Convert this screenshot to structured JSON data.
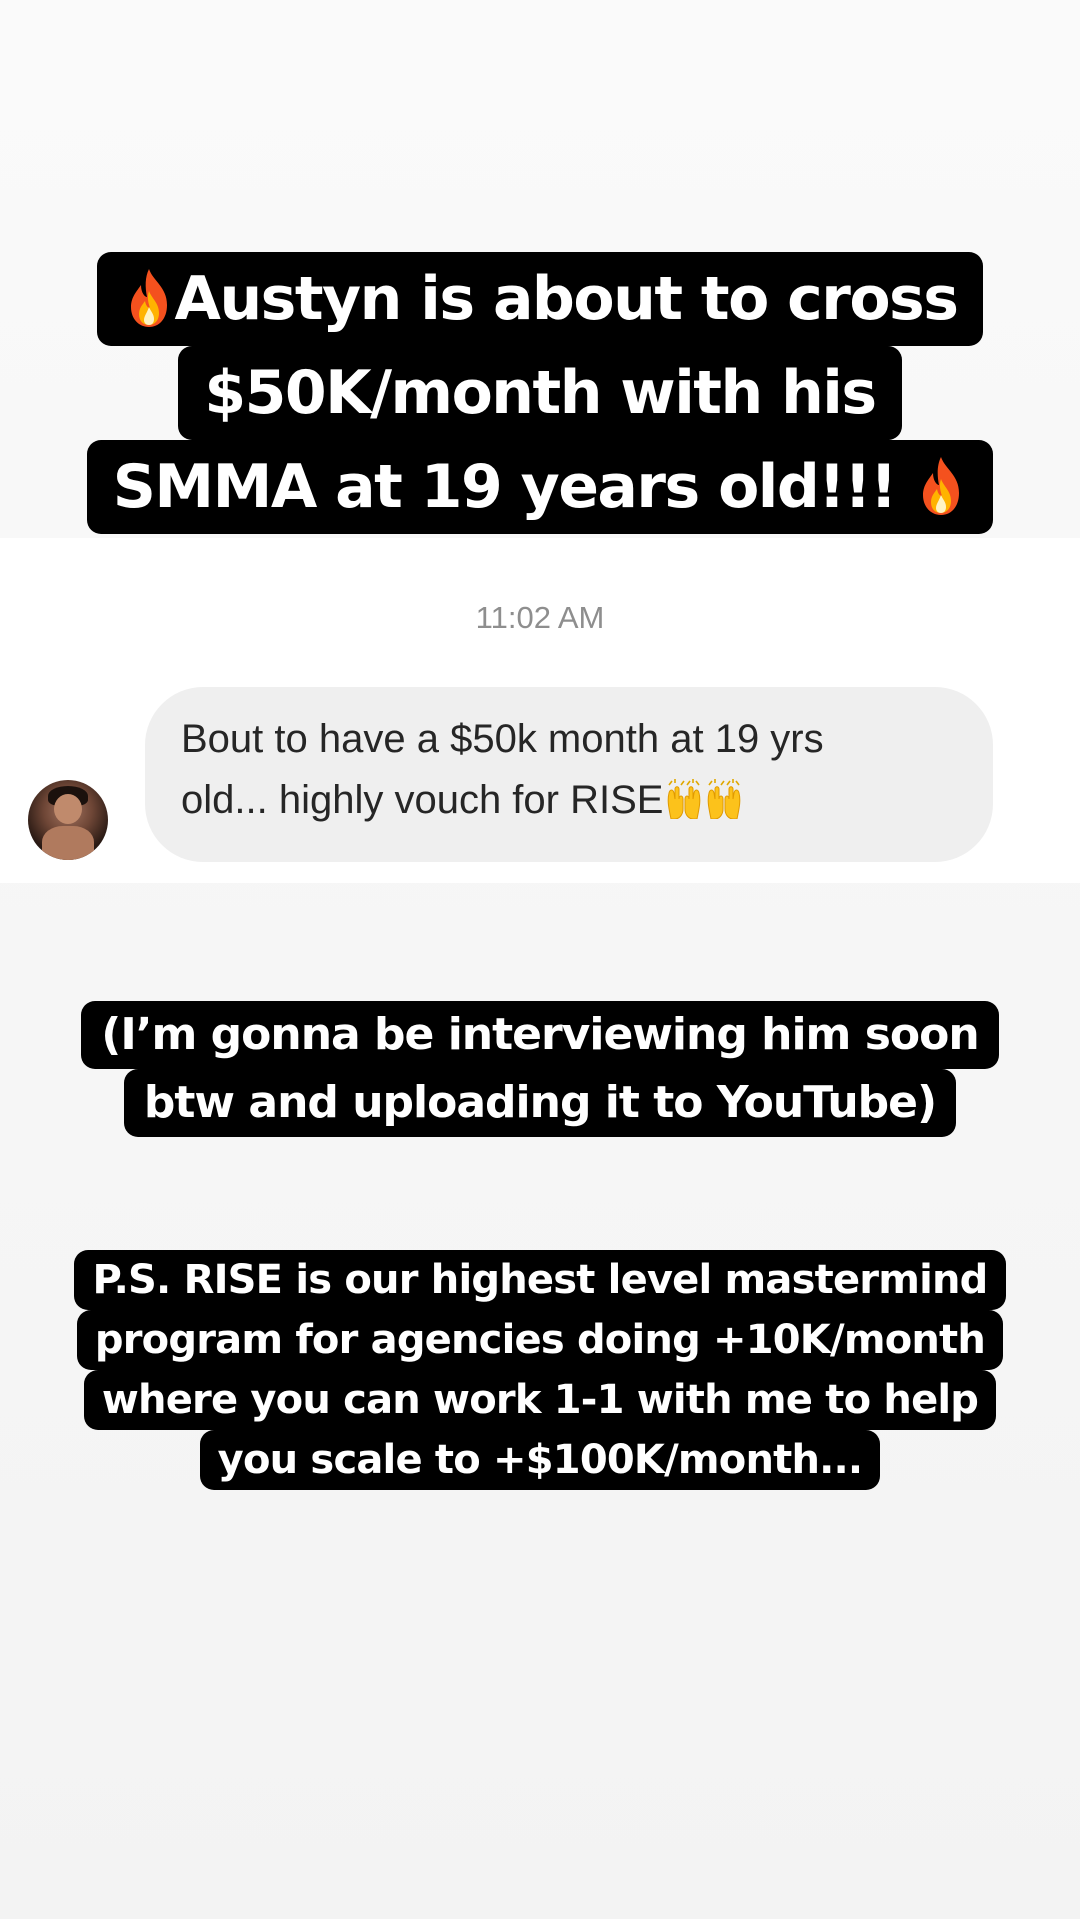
{
  "headline": {
    "lines": [
      "Austyn is about to cross",
      "$50K/month with his",
      "SMMA at 19 years old!!!"
    ],
    "leading_icon": "fire-emoji",
    "trailing_icon": "fire-emoji"
  },
  "dm": {
    "timestamp": "11:02 AM",
    "message_lines": [
      "Bout to have a $50k month at 19 yrs",
      "old... highly vouch for RISE"
    ],
    "trailing_icons": [
      "raising-hands-emoji",
      "raising-hands-emoji"
    ],
    "avatar": "sender-avatar"
  },
  "note": {
    "lines": [
      "(I’m gonna be interviewing him soon",
      "btw and uploading it to YouTube)"
    ]
  },
  "ps": {
    "lines": [
      "P.S. RISE is our highest level mastermind",
      "program for agencies doing +10K/month",
      "where you can work 1-1 with me to help",
      "you scale to +$100K/month..."
    ]
  },
  "colors": {
    "caption_background": "#000000",
    "caption_text": "#ffffff",
    "bubble_background": "#efefef",
    "timestamp_text": "#8e8e8e"
  }
}
